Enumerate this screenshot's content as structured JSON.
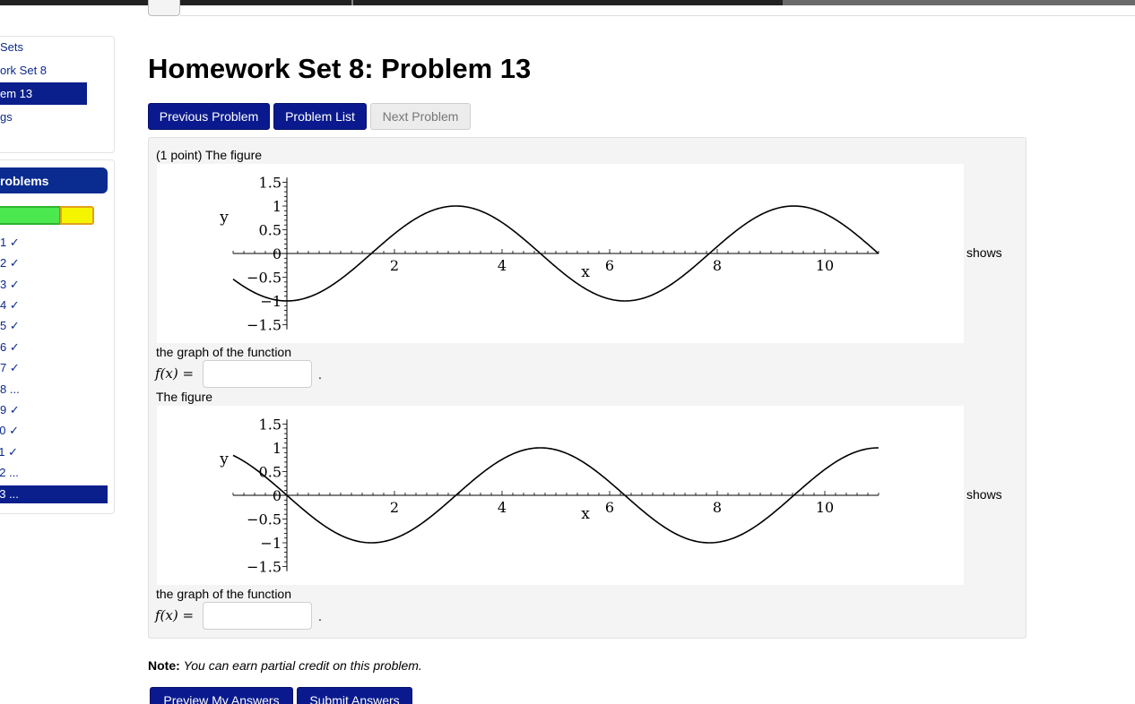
{
  "nav": {
    "links": [
      "Sets",
      "ork Set 8",
      "em 13",
      "gs"
    ],
    "problems_header": "roblems",
    "progress": {
      "correct_fraction": 0.65,
      "incomplete_fraction": 0.35
    },
    "problems": [
      "1 ✓",
      "2 ✓",
      "3 ✓",
      "4 ✓",
      "5 ✓",
      "6 ✓",
      "7 ✓",
      "8 ...",
      "9 ✓",
      "10 ✓",
      "11 ✓",
      "12 ...",
      "13 ..."
    ]
  },
  "page": {
    "title": "Homework Set 8: Problem 13",
    "buttons": {
      "previous": "Previous Problem",
      "list": "Problem List",
      "next": "Next Problem"
    }
  },
  "problem": {
    "intro": "(1 point) The figure",
    "shows": "shows",
    "graph_of": "the graph of the function",
    "fx_label": "f(x) =",
    "period": ".",
    "figure2": "The figure",
    "answer1": "",
    "answer2": ""
  },
  "chart_data": [
    {
      "type": "line",
      "xlabel": "x",
      "ylabel": "y",
      "xlim": [
        -1,
        11
      ],
      "ylim": [
        -1.5,
        1.5
      ],
      "xticks": [
        "2",
        "4",
        "6",
        "8",
        "10"
      ],
      "yticks": [
        "1.5",
        "1",
        "0.5",
        "0",
        "−0.5",
        "−1",
        "−1.5"
      ],
      "series": [
        {
          "function": "-cos(x)",
          "x_range": [
            -1,
            11
          ]
        }
      ]
    },
    {
      "type": "line",
      "xlabel": "x",
      "ylabel": "y",
      "xlim": [
        -1,
        11
      ],
      "ylim": [
        -1.5,
        1.5
      ],
      "xticks": [
        "2",
        "4",
        "6",
        "8",
        "10"
      ],
      "yticks": [
        "1.5",
        "1",
        "0.5",
        "0",
        "−0.5",
        "−1",
        "−1.5"
      ],
      "series": [
        {
          "function": "-sin(x)",
          "x_range": [
            -1,
            11
          ]
        }
      ]
    }
  ],
  "footer": {
    "note_label": "Note:",
    "note_text": "You can earn partial credit on this problem.",
    "preview": "Preview My Answers",
    "submit": "Submit Answers"
  }
}
